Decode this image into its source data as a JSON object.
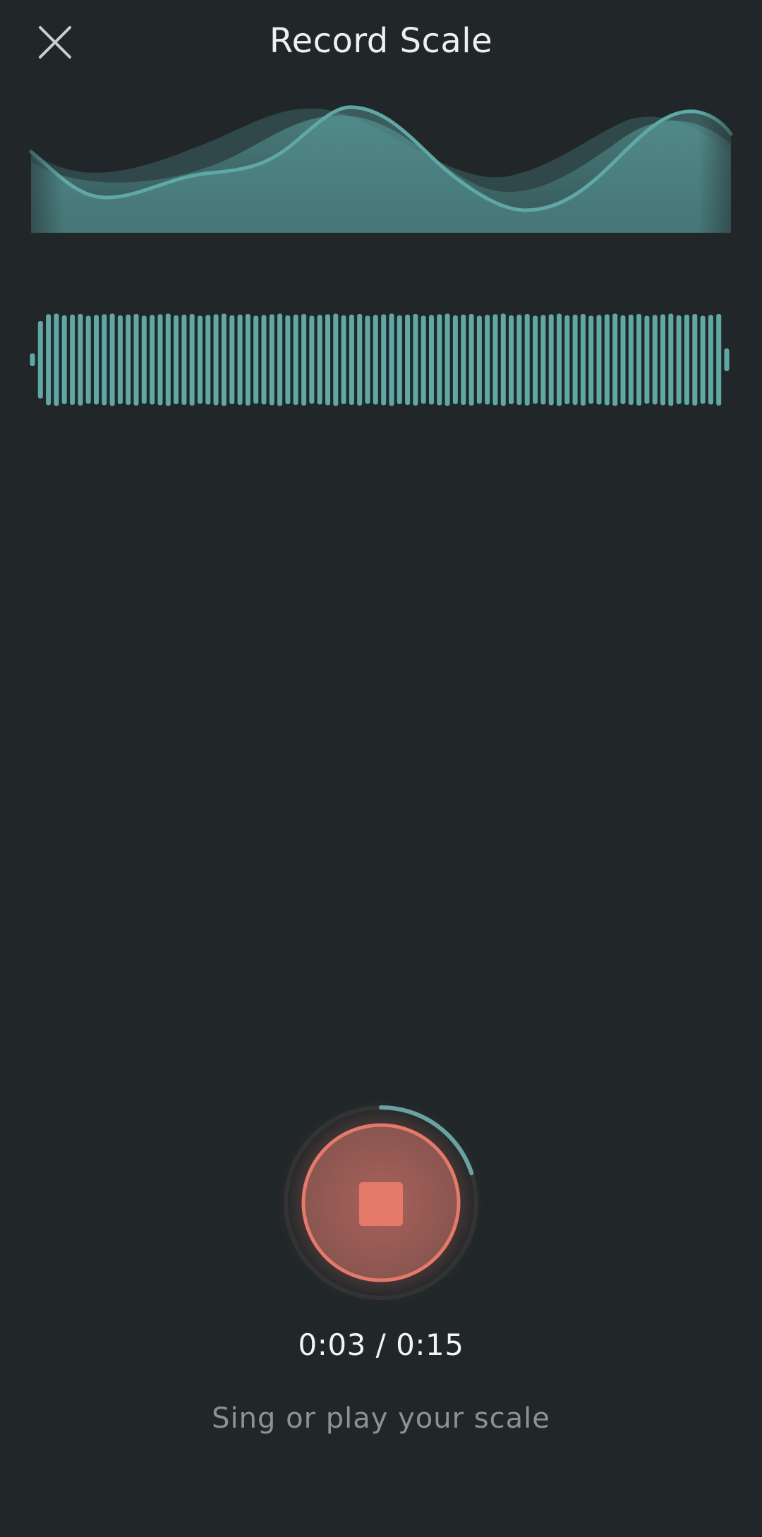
{
  "header": {
    "title": "Record Scale",
    "close_icon": "close-icon"
  },
  "waveform": {
    "bar_count": 88,
    "color": "#5fa8a6"
  },
  "recorder": {
    "timer": "0:03 / 0:15",
    "progress_fraction": 0.2,
    "stop_icon": "stop-icon",
    "accent_color": "#e57a6b",
    "progress_color": "#6aa2a4"
  },
  "hint": {
    "text": "Sing or play your scale"
  }
}
